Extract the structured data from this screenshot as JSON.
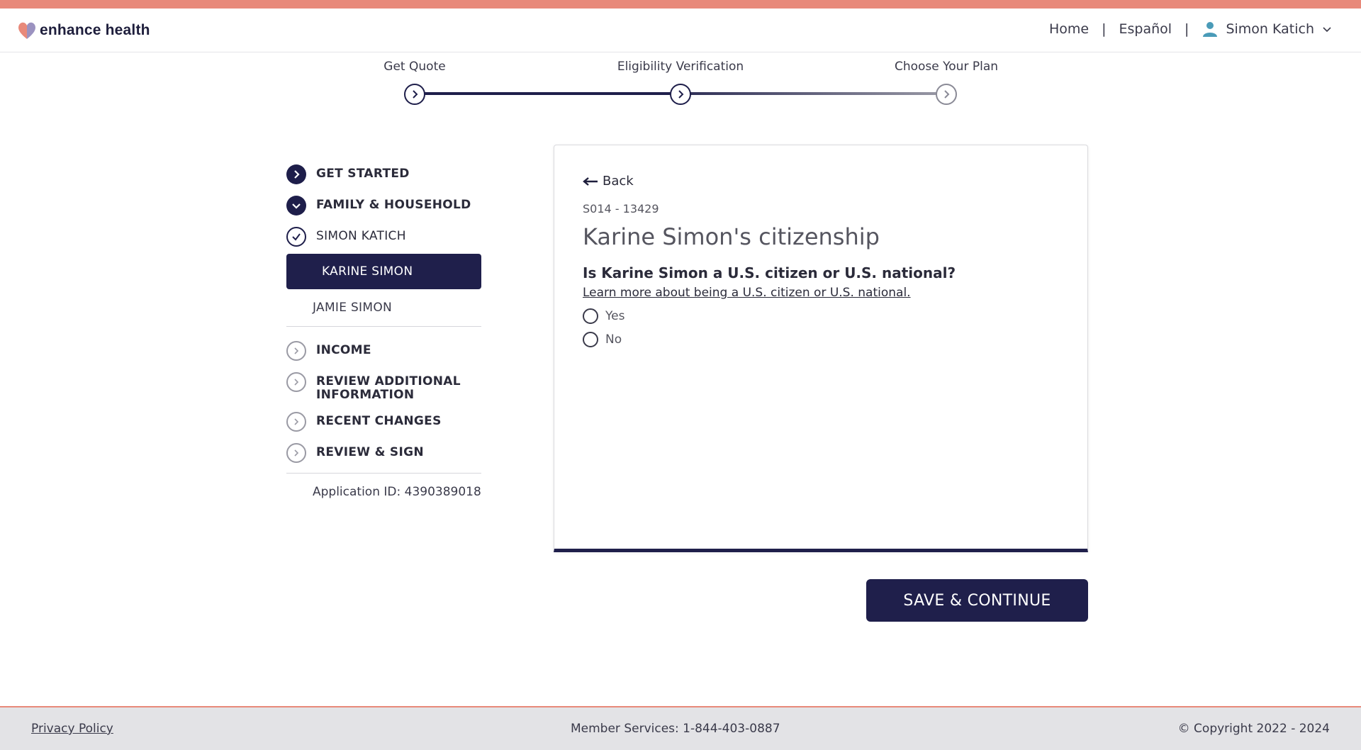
{
  "brand": {
    "name": "enhance health",
    "accent": "#e8897a",
    "primary": "#1f1f4b"
  },
  "nav": {
    "home": "Home",
    "language": "Español",
    "user_name": "Simon Katich"
  },
  "stepper": {
    "steps": [
      {
        "label": "Get Quote",
        "state": "complete"
      },
      {
        "label": "Eligibility Verification",
        "state": "current"
      },
      {
        "label": "Choose Your Plan",
        "state": "upcoming"
      }
    ]
  },
  "sidebar": {
    "get_started": "GET STARTED",
    "family_household": "FAMILY & HOUSEHOLD",
    "simon_katich": "SIMON KATICH",
    "karine_simon": "KARINE SIMON",
    "jamie_simon": "JAMIE SIMON",
    "income": "INCOME",
    "review_additional_line1": "REVIEW ADDITIONAL",
    "review_additional_line2": "INFORMATION",
    "recent_changes": "RECENT CHANGES",
    "review_sign": "REVIEW & SIGN",
    "application_id": "Application ID: 4390389018"
  },
  "card": {
    "back_label": "Back",
    "case_number": "S014 - 13429",
    "title": "Karine Simon's citizenship",
    "question": "Is Karine Simon a U.S. citizen or U.S. national?",
    "learn_more": "Learn more about being a U.S. citizen or U.S. national.",
    "options": [
      "Yes",
      "No"
    ]
  },
  "actions": {
    "save_continue": "SAVE & CONTINUE"
  },
  "footer": {
    "privacy": "Privacy Policy",
    "member_services": "Member Services: 1-844-403-0887",
    "copyright": "© Copyright 2022 - 2024"
  }
}
